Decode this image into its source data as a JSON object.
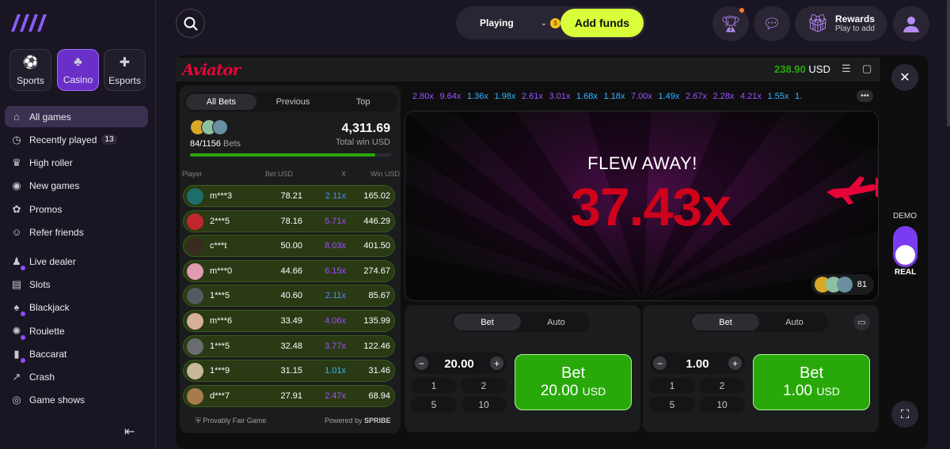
{
  "categories": [
    {
      "label": "Sports",
      "icon": "ball-icon"
    },
    {
      "label": "Casino",
      "icon": "cards-icon"
    },
    {
      "label": "Esports",
      "icon": "gamepad-icon"
    }
  ],
  "nav": [
    {
      "label": "All games",
      "icon": "home-icon"
    },
    {
      "label": "Recently played",
      "icon": "clock-icon",
      "badge": "13"
    },
    {
      "label": "High roller",
      "icon": "crown-icon"
    },
    {
      "label": "New games",
      "icon": "globe-icon"
    },
    {
      "label": "Promos",
      "icon": "gift-icon"
    },
    {
      "label": "Refer friends",
      "icon": "users-icon"
    },
    {
      "label": "Live dealer",
      "icon": "dealer-icon"
    },
    {
      "label": "Slots",
      "icon": "slots-icon"
    },
    {
      "label": "Blackjack",
      "icon": "blackjack-icon"
    },
    {
      "label": "Roulette",
      "icon": "roulette-icon"
    },
    {
      "label": "Baccarat",
      "icon": "baccarat-icon"
    },
    {
      "label": "Crash",
      "icon": "crash-icon"
    },
    {
      "label": "Game shows",
      "icon": "gameshow-icon"
    }
  ],
  "topbar": {
    "status": "Playing",
    "add_funds": "Add funds",
    "rewards_title": "Rewards",
    "rewards_sub": "Play to add"
  },
  "game": {
    "name": "Aviator",
    "balance": "238.90",
    "currency": "USD"
  },
  "bets_tabs": [
    "All Bets",
    "Previous",
    "Top"
  ],
  "bets_summary": {
    "count": "84/1156",
    "count_label": "Bets",
    "total": "4,311.69",
    "total_label": "Total win USD",
    "progress": 0.92
  },
  "columns": [
    "Player",
    "Bet USD",
    "X",
    "Win USD"
  ],
  "bets": [
    {
      "player": "m***3",
      "bet": "78.21",
      "x": "2.11x",
      "win": "165.02",
      "xc": "#4e8cff",
      "av": "#1c6e6a"
    },
    {
      "player": "2***5",
      "bet": "78.16",
      "x": "5.71x",
      "win": "446.29",
      "xc": "#a050ff",
      "av": "#c0262c"
    },
    {
      "player": "c***t",
      "bet": "50.00",
      "x": "8.03x",
      "win": "401.50",
      "xc": "#a050ff",
      "av": "#3a2a20"
    },
    {
      "player": "m***0",
      "bet": "44.66",
      "x": "6.15x",
      "win": "274.67",
      "xc": "#a050ff",
      "av": "#e29ab0"
    },
    {
      "player": "1***5",
      "bet": "40.60",
      "x": "2.11x",
      "win": "85.67",
      "xc": "#4e8cff",
      "av": "#555a60"
    },
    {
      "player": "m***6",
      "bet": "33.49",
      "x": "4.06x",
      "win": "135.99",
      "xc": "#a050ff",
      "av": "#d7b09a"
    },
    {
      "player": "1***5",
      "bet": "32.48",
      "x": "3.77x",
      "win": "122.46",
      "xc": "#a050ff",
      "av": "#6a6c70"
    },
    {
      "player": "1***9",
      "bet": "31.15",
      "x": "1.01x",
      "win": "31.46",
      "xc": "#34b4ff",
      "av": "#c8b89a"
    },
    {
      "player": "d***7",
      "bet": "27.91",
      "x": "2.47x",
      "win": "68.94",
      "xc": "#a050ff",
      "av": "#a87c4a"
    }
  ],
  "footer": {
    "fair": "Provably Fair Game",
    "powered": "Powered by",
    "brand": "SPRIBE"
  },
  "history": [
    {
      "v": "2.80x",
      "c": "#a050ff"
    },
    {
      "v": "9.64x",
      "c": "#a050ff"
    },
    {
      "v": "1.36x",
      "c": "#34b4ff"
    },
    {
      "v": "1.98x",
      "c": "#34b4ff"
    },
    {
      "v": "2.61x",
      "c": "#a050ff"
    },
    {
      "v": "3.01x",
      "c": "#a050ff"
    },
    {
      "v": "1.68x",
      "c": "#34b4ff"
    },
    {
      "v": "1.18x",
      "c": "#34b4ff"
    },
    {
      "v": "7.00x",
      "c": "#a050ff"
    },
    {
      "v": "1.49x",
      "c": "#34b4ff"
    },
    {
      "v": "2.67x",
      "c": "#a050ff"
    },
    {
      "v": "2.28x",
      "c": "#a050ff"
    },
    {
      "v": "4.21x",
      "c": "#a050ff"
    },
    {
      "v": "1.55x",
      "c": "#34b4ff"
    },
    {
      "v": "1.",
      "c": "#34b4ff"
    }
  ],
  "round": {
    "status": "FLEW AWAY!",
    "multiplier": "37.43x",
    "online": "81"
  },
  "bet_panels": [
    {
      "tabs": [
        "Bet",
        "Auto"
      ],
      "amount": "20.00",
      "quick": [
        "1",
        "2",
        "5",
        "10"
      ],
      "btn_title": "Bet",
      "btn_amount": "20.00",
      "btn_currency": "USD"
    },
    {
      "tabs": [
        "Bet",
        "Auto"
      ],
      "amount": "1.00",
      "quick": [
        "1",
        "2",
        "5",
        "10"
      ],
      "btn_title": "Bet",
      "btn_amount": "1.00",
      "btn_currency": "USD"
    }
  ],
  "mode": {
    "demo": "DEMO",
    "real": "REAL"
  },
  "colors": {
    "accent": "#6a2fc9",
    "add_funds": "#d8ff3a",
    "win_green": "#28a909",
    "crash_red": "#d0021b",
    "brand_red": "#e50539"
  }
}
